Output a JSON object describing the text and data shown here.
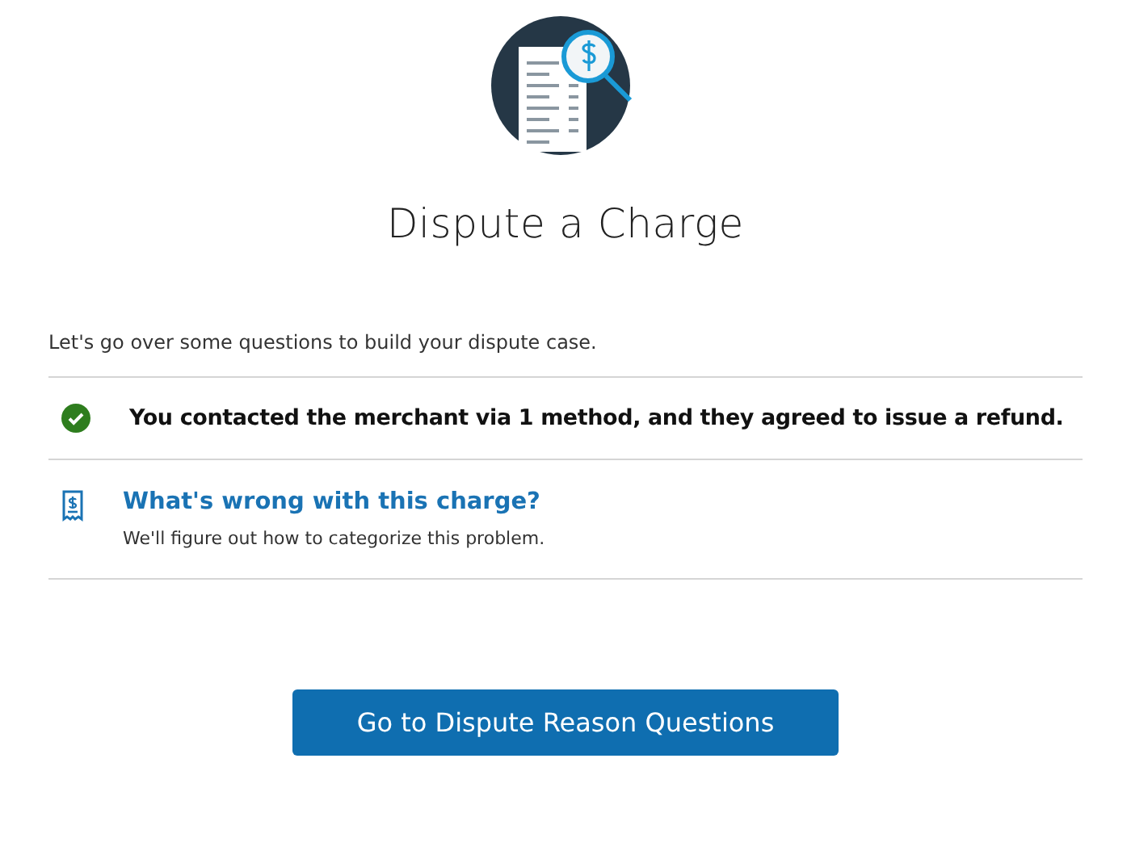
{
  "title": "Dispute a Charge",
  "intro": "Let's go over some questions to build your dispute case.",
  "steps": [
    {
      "kind": "completed",
      "title": "You contacted the merchant via 1 method, and they agreed to issue a refund."
    },
    {
      "kind": "pending",
      "title": "What's wrong with this charge?",
      "subtitle": "We'll figure out how to categorize this problem."
    }
  ],
  "button": "Go to Dispute Reason Questions"
}
